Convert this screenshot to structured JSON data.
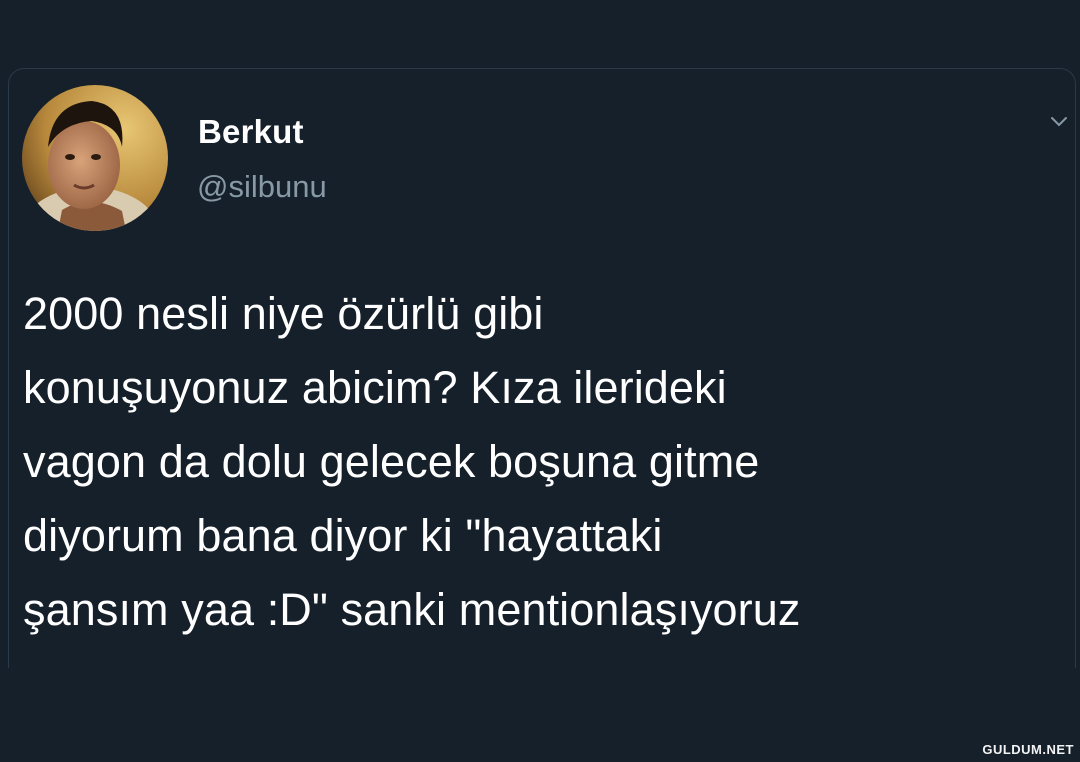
{
  "tweet": {
    "display_name": "Berkut",
    "handle": "@silbunu",
    "text": "2000 nesli niye özürlü gibi\nkonuşuyonuz abicim? Kıza ilerideki\nvagon da dolu gelecek boşuna gitme\ndiyorum bana diyor ki \"hayattaki\nşansım yaa :D\" sanki mentionlaşıyoruz",
    "menu_icon": "chevron-down-icon"
  },
  "watermark": "GULDUM.NET",
  "colors": {
    "background": "#15202b",
    "text": "#ffffff",
    "muted": "#8899a6"
  }
}
